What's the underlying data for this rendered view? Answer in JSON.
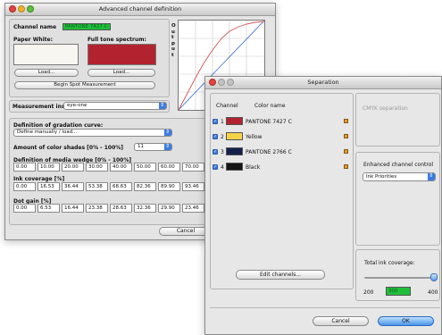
{
  "colors": {
    "paper_white": "#f8f6f0",
    "full_tone": "#b3232f",
    "accent": "#3b7be0",
    "ink_value_bg": "#1fbf3a"
  },
  "main_window": {
    "title": "Advanced channel definition",
    "channel_name_label": "Channel name",
    "channel_name_value": "PANTONE 7427 C",
    "paper_white_label": "Paper White:",
    "full_tone_label": "Full tone spectrum:",
    "load_label": "Load...",
    "begin_spot_label": "Begin Spot Measurement",
    "measurement_label": "Measurement instr.",
    "measurement_value": "eye-one",
    "graph_axis_label": "O u t p u t",
    "definition_label": "Definition of gradation curve:",
    "definition_value": "Define manually / load...",
    "shades_label": "Amount of color shades [0% - 100%]",
    "shades_value": "11",
    "media_wedge_label": "Definition of media wedge [0% - 100%]",
    "media_wedge_values": [
      "0.00",
      "10.00",
      "20.00",
      "30.00",
      "40.00",
      "50.00",
      "60.00",
      "70.00",
      "8"
    ],
    "ink_coverage_label": "Ink coverage [%]",
    "ink_coverage_values": [
      "0.00",
      "16.53",
      "36.44",
      "53.38",
      "68.63",
      "82.36",
      "89.90",
      "93.46",
      "9"
    ],
    "dot_gain_label": "Dot gain [%]",
    "dot_gain_values": [
      "0.00",
      "6.53",
      "16.44",
      "23.38",
      "28.63",
      "32.36",
      "29.90",
      "23.46",
      "1"
    ],
    "cancel_label": "Cancel"
  },
  "separation_window": {
    "title": "Separation",
    "channel_header": "Channel",
    "color_name_header": "Color name",
    "channels": [
      {
        "num": "1",
        "name": "PANTONE 7427 C",
        "color": "#b3232f"
      },
      {
        "num": "2",
        "name": "Yellow",
        "color": "#f5d247"
      },
      {
        "num": "3",
        "name": "PANTONE 2766 C",
        "color": "#14204a"
      },
      {
        "num": "4",
        "name": "Black",
        "color": "#141414"
      }
    ],
    "edit_channels_label": "Edit channels...",
    "cmyk_label": "CMYK separation",
    "enhanced_label": "Enhanced channel control",
    "enhanced_value": "Ink Priorities",
    "total_ink_label": "Total ink coverage:",
    "total_min": "200",
    "total_value": "300",
    "total_max": "400",
    "cancel_label": "Cancel",
    "ok_label": "OK"
  }
}
